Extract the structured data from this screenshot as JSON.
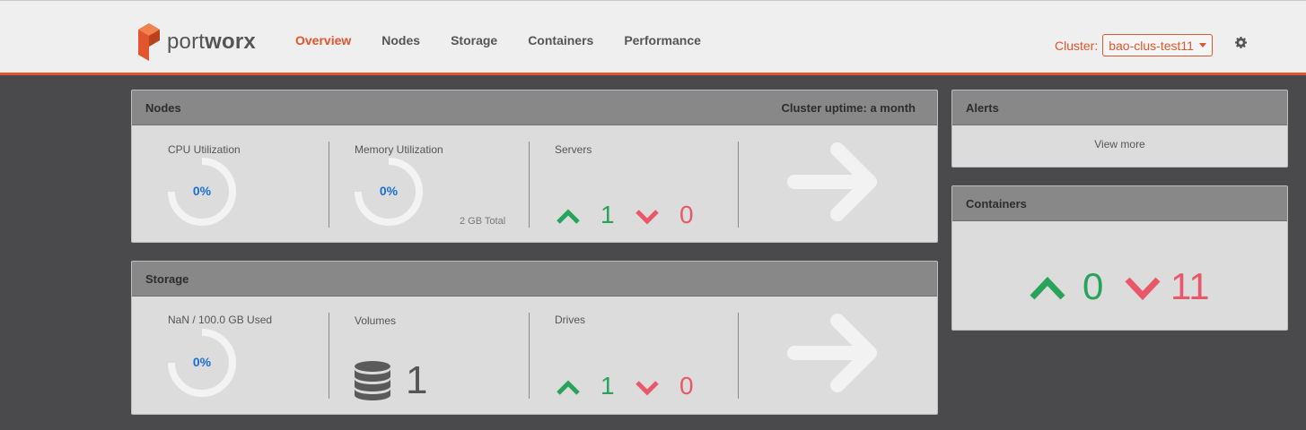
{
  "brand": {
    "name_light": "port",
    "name_bold": "worx",
    "logo_color": "#e0552b"
  },
  "nav": {
    "items": [
      {
        "label": "Overview",
        "active": true
      },
      {
        "label": "Nodes",
        "active": false
      },
      {
        "label": "Storage",
        "active": false
      },
      {
        "label": "Containers",
        "active": false
      },
      {
        "label": "Performance",
        "active": false
      }
    ]
  },
  "cluster": {
    "label": "Cluster:",
    "selected": "bao-clus-test11"
  },
  "settings": {
    "icon": "gear-icon"
  },
  "nodes_panel": {
    "title": "Nodes",
    "uptime": "Cluster uptime: a month",
    "cpu": {
      "label": "CPU Utilization",
      "value": "0%",
      "fraction": 0.0
    },
    "memory": {
      "label": "Memory Utilization",
      "value": "0%",
      "fraction": 0.0,
      "total": "2 GB Total"
    },
    "servers": {
      "label": "Servers",
      "up": "1",
      "down": "0"
    }
  },
  "storage_panel": {
    "title": "Storage",
    "used": {
      "label": "NaN / 100.0 GB Used",
      "value": "0%",
      "fraction": 0.0
    },
    "volumes": {
      "label": "Volumes",
      "count": "1",
      "icon": "database-icon"
    },
    "drives": {
      "label": "Drives",
      "up": "1",
      "down": "0"
    }
  },
  "alerts_panel": {
    "title": "Alerts",
    "view_more": "View more"
  },
  "containers_panel": {
    "title": "Containers",
    "up": "0",
    "down": "11"
  },
  "colors": {
    "accent": "#e0552b",
    "up": "#27a35a",
    "down": "#e85868",
    "percent": "#1b6ed0"
  }
}
